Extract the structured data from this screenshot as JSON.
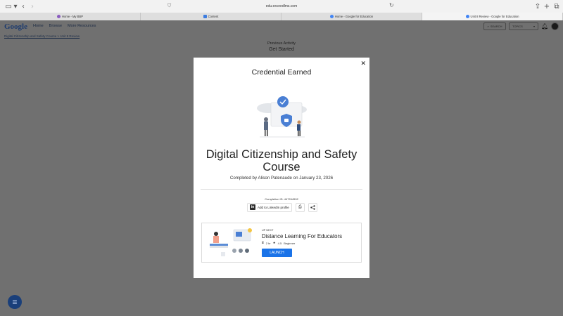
{
  "browser": {
    "url": "edu.exceedlms.com",
    "tabs": [
      {
        "label": "Home - My BBP",
        "favicon_color": "#8a5cc0"
      },
      {
        "label": "Content",
        "favicon_color": "#3d7de0"
      },
      {
        "label": "Home - Google for Education",
        "favicon_color": "#4285f4"
      },
      {
        "label": "Unit 8 Review - Google for Education",
        "favicon_color": "#4285f4",
        "active": true
      }
    ]
  },
  "header": {
    "logo": "Google",
    "nav": [
      "Home",
      "Browse",
      "More Resources"
    ],
    "breadcrumb": "Digital Citizenship and Safety Course > Unit 8 Review",
    "search_label": "SEARCH",
    "topics_label": "TOPICS"
  },
  "background": {
    "previous_activity": "Previous Activity",
    "get_started": "Get Started"
  },
  "modal": {
    "title": "Credential Earned",
    "course_title": "Digital Citizenship and Safety Course",
    "completed_by": "Completed by Alison Patenaude on January 23, 2026",
    "completion_id": "Completion ID: 447244592",
    "linkedin_label": "Add to LinkedIn profile",
    "up_next": {
      "label": "UP NEXT",
      "title": "Distance Learning For Educators",
      "duration": "2 hr",
      "rating": "4.5",
      "level": "Beginner",
      "launch_label": "LAUNCH"
    }
  },
  "colors": {
    "accent": "#1a73e8",
    "overlay": "#707070",
    "fab": "#1a3f7a"
  }
}
